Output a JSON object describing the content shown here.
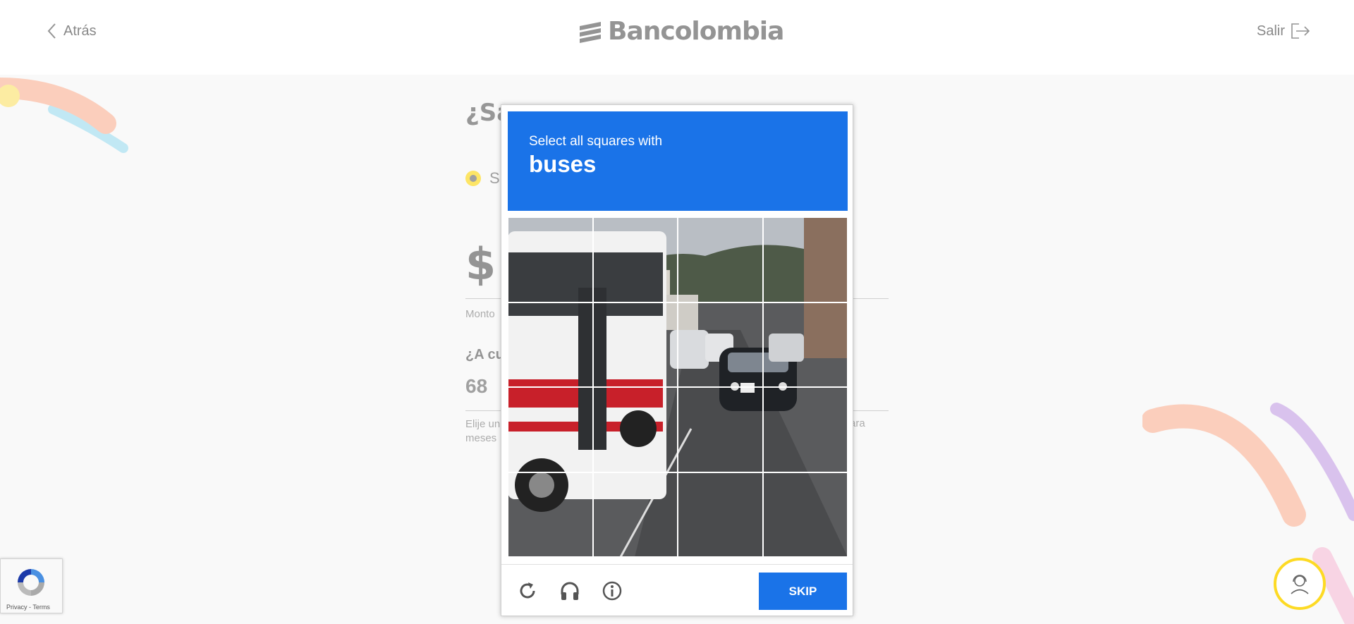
{
  "header": {
    "back_label": "Atrás",
    "logo_text": "Bancolombia",
    "exit_label": "Salir"
  },
  "form": {
    "question": "¿Sa",
    "radio_option": "Sí",
    "currency_symbol": "$",
    "amount_label": "Monto",
    "term_question": "¿A cu",
    "term_value": "68",
    "term_help_left": "Elije un",
    "term_help_left_2": "meses",
    "term_help_right": "ara"
  },
  "captcha": {
    "instruction": "Select all squares with",
    "target": "buses",
    "skip_label": "SKIP",
    "accent_color": "#1a73e8"
  },
  "recaptcha_badge": {
    "links": "Privacy - Terms"
  },
  "colors": {
    "brand_yellow": "#fdda24",
    "background": "#f7f7f7"
  }
}
